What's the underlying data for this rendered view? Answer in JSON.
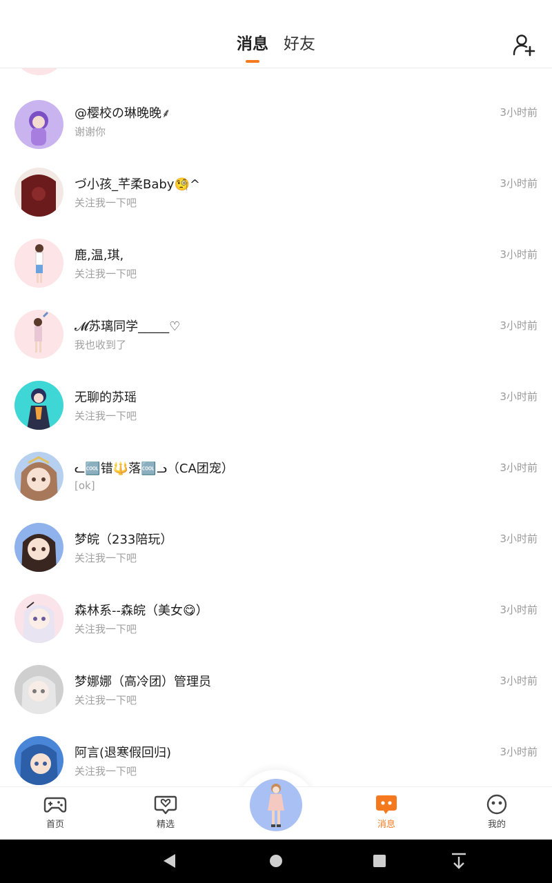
{
  "header": {
    "tabs": [
      {
        "label": "消息",
        "active": true
      },
      {
        "label": "好友",
        "active": false
      }
    ],
    "add_friend_icon": "person-add-icon",
    "accent_color": "#f57a1f"
  },
  "conversations": [
    {
      "name": "@樱校の琳晚晚⸙",
      "preview": "谢谢你",
      "time": "3小时前",
      "avatar_color": "#c9b4f0"
    },
    {
      "name": "づ小孩_芊柔Baby🧐^",
      "preview": "关注我一下吧",
      "time": "3小时前",
      "avatar_color": "#7a2a2a"
    },
    {
      "name": "鹿,温,琪,",
      "preview": "关注我一下吧",
      "time": "3小时前",
      "avatar_color": "#fde4e6"
    },
    {
      "name": "𝓜苏璃同学_____♡",
      "preview": "我也收到了",
      "time": "3小时前",
      "avatar_color": "#fde4e6"
    },
    {
      "name": "无聊的苏瑶",
      "preview": "关注我一下吧",
      "time": "3小时前",
      "avatar_color": "#3fd6d6"
    },
    {
      "name": "ᓚ🆒错🔱落🆒ᓗ（CA团宠）",
      "preview": "[ok]",
      "time": "3小时前",
      "avatar_color": "#b8d0f0"
    },
    {
      "name": "梦皖（233陪玩）",
      "preview": "关注我一下吧",
      "time": "3小时前",
      "avatar_color": "#8fb2ec"
    },
    {
      "name": "森林系--森皖（美女😋）",
      "preview": "关注我一下吧",
      "time": "3小时前",
      "avatar_color": "#fbe3ea"
    },
    {
      "name": "梦娜娜（高冷团）管理员",
      "preview": "关注我一下吧",
      "time": "3小时前",
      "avatar_color": "#cfcfcf"
    },
    {
      "name": "阿言(退寒假回归)",
      "preview": "关注我一下吧",
      "time": "3小时前",
      "avatar_color": "#4a86d8"
    }
  ],
  "bottom_nav": [
    {
      "label": "首页",
      "icon": "gamepad-icon",
      "active": false
    },
    {
      "label": "精选",
      "icon": "heart-chat-icon",
      "active": false
    },
    {
      "label": "消息",
      "icon": "message-icon",
      "active": true
    },
    {
      "label": "我的",
      "icon": "face-icon",
      "active": false
    }
  ],
  "system_bar": {
    "buttons": [
      "back-icon",
      "home-icon",
      "recents-icon",
      "notification-pull-icon"
    ]
  }
}
